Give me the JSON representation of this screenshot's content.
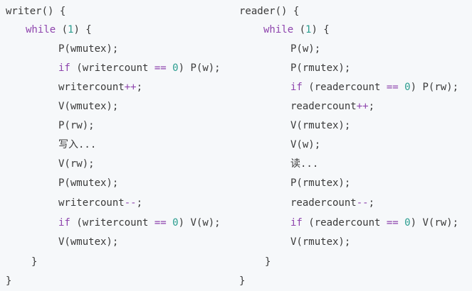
{
  "writer": {
    "lines": [
      "writer() {",
      "while (1) {",
      "P(wmutex);",
      "if (writercount == 0) P(w);",
      "writercount++;",
      "V(wmutex);",
      "P(rw);",
      "写入...",
      "V(rw);",
      "P(wmutex);",
      "writercount--;",
      "if (writercount == 0) V(w);",
      "V(wmutex);",
      "}",
      "}"
    ]
  },
  "reader": {
    "lines": [
      "reader() {",
      "while (1) {",
      "P(w);",
      "P(rmutex);",
      "if (readercount == 0) P(rw);",
      "readercount++;",
      "V(rmutex);",
      "V(w);",
      "读...",
      "P(rmutex);",
      "readercount--;",
      "if (readercount == 0) V(rw);",
      "V(rmutex);",
      "}",
      "}"
    ]
  },
  "colors": {
    "keyword": "#8e44ad",
    "number": "#2a9d8f",
    "text": "#3a3a3a",
    "background": "#f6f8fa"
  }
}
